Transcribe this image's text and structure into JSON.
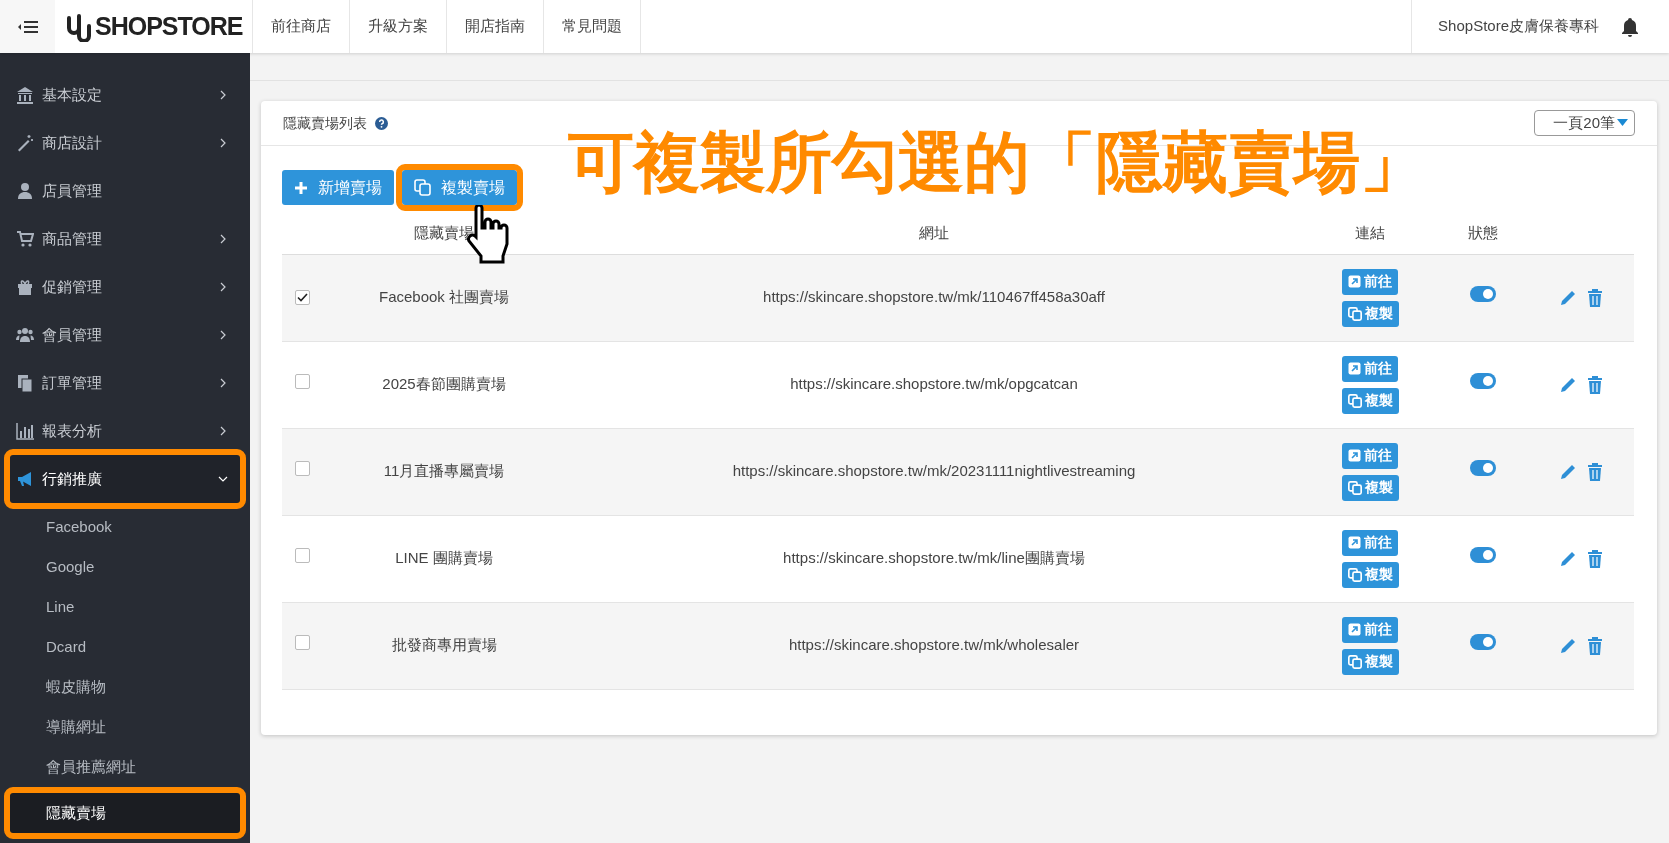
{
  "header": {
    "brand": "SHOPSTORE",
    "nav": [
      "前往商店",
      "升級方案",
      "開店指南",
      "常見問題"
    ],
    "store_name": "ShopStore皮膚保養專科"
  },
  "sidebar": {
    "items": [
      {
        "label": "基本設定",
        "expandable": true,
        "expanded": false,
        "highlighted": false
      },
      {
        "label": "商店設計",
        "expandable": true,
        "expanded": false,
        "highlighted": false
      },
      {
        "label": "店員管理",
        "expandable": false,
        "expanded": false,
        "highlighted": false
      },
      {
        "label": "商品管理",
        "expandable": true,
        "expanded": false,
        "highlighted": false
      },
      {
        "label": "促銷管理",
        "expandable": true,
        "expanded": false,
        "highlighted": false
      },
      {
        "label": "會員管理",
        "expandable": true,
        "expanded": false,
        "highlighted": false
      },
      {
        "label": "訂單管理",
        "expandable": true,
        "expanded": false,
        "highlighted": false
      },
      {
        "label": "報表分析",
        "expandable": true,
        "expanded": false,
        "highlighted": false
      },
      {
        "label": "行銷推廣",
        "expandable": true,
        "expanded": true,
        "highlighted": true,
        "children": [
          {
            "label": "Facebook",
            "selected": false,
            "highlighted": false
          },
          {
            "label": "Google",
            "selected": false,
            "highlighted": false
          },
          {
            "label": "Line",
            "selected": false,
            "highlighted": false
          },
          {
            "label": "Dcard",
            "selected": false,
            "highlighted": false
          },
          {
            "label": "蝦皮購物",
            "selected": false,
            "highlighted": false
          },
          {
            "label": "導購網址",
            "selected": false,
            "highlighted": false
          },
          {
            "label": "會員推薦網址",
            "selected": false,
            "highlighted": false
          },
          {
            "label": "隱藏賣場",
            "selected": true,
            "highlighted": true
          }
        ]
      }
    ]
  },
  "card": {
    "title": "隱藏賣場列表",
    "page_size": "一頁20筆",
    "buttons": [
      {
        "label": "新增賣場",
        "kind": "add",
        "highlighted": false
      },
      {
        "label": "複製賣場",
        "kind": "copy",
        "highlighted": true
      }
    ],
    "annotation": "可複製所勾選的「隱藏賣場」",
    "table": {
      "columns": [
        "隱藏賣場",
        "網址",
        "連結",
        "狀態"
      ],
      "rows": [
        {
          "checked": true,
          "name": "Facebook 社團賣場",
          "url": "https://skincare.shopstore.tw/mk/110467ff458a30aff",
          "go": "前往",
          "copy": "複製",
          "on": true
        },
        {
          "checked": false,
          "name": "2025春節團購賣場",
          "url": "https://skincare.shopstore.tw/mk/opgcatcan",
          "go": "前往",
          "copy": "複製",
          "on": true
        },
        {
          "checked": false,
          "name": "11月直播專屬賣場",
          "url": "https://skincare.shopstore.tw/mk/20231111nightlivestreaming",
          "go": "前往",
          "copy": "複製",
          "on": true
        },
        {
          "checked": false,
          "name": "LINE 團購賣場",
          "url": "https://skincare.shopstore.tw/mk/line團購賣場",
          "go": "前往",
          "copy": "複製",
          "on": true
        },
        {
          "checked": false,
          "name": "批發商專用賣場",
          "url": "https://skincare.shopstore.tw/mk/wholesaler",
          "go": "前往",
          "copy": "複製",
          "on": true
        }
      ]
    }
  }
}
